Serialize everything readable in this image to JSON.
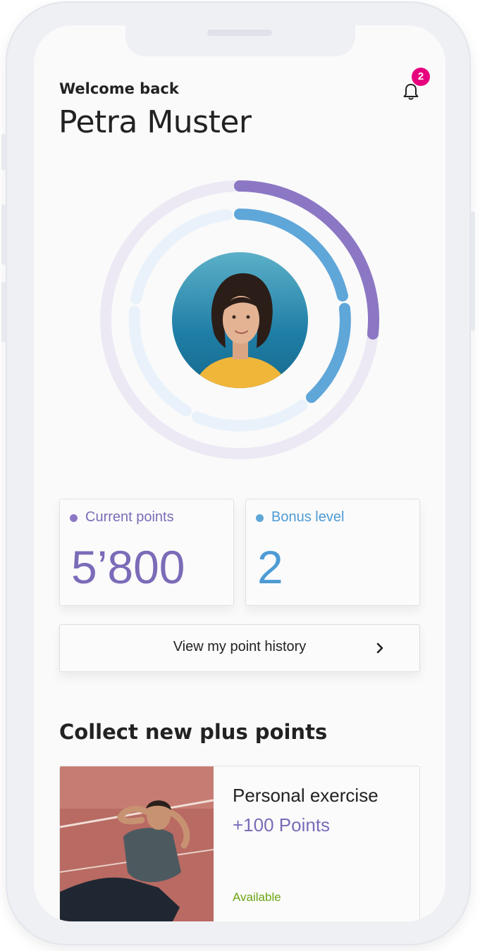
{
  "header": {
    "greeting": "Welcome back",
    "user_name": "Petra Muster",
    "notification_count": "2",
    "icon": "bell-icon"
  },
  "progress_rings": {
    "outer_color": "#8c77c4",
    "inner_color": "#5fa6d9",
    "track_color": "#ece9f4"
  },
  "stats": {
    "current_points": {
      "label": "Current points",
      "value": "5’800",
      "color": "#7b6bb8"
    },
    "bonus_level": {
      "label": "Bonus level",
      "value": "2",
      "color": "#4d9bd4"
    }
  },
  "history_button": {
    "label": "View my point history",
    "icon": "chevron-right-icon"
  },
  "collect": {
    "title": "Collect new plus points",
    "offers": [
      {
        "title": "Personal exercise",
        "points": "+100 Points",
        "status": "Available",
        "status_color": "#6aa414"
      }
    ]
  },
  "colors": {
    "accent": "#7b6bb8",
    "badge": "#e6007e",
    "secondary": "#4d9bd4"
  }
}
